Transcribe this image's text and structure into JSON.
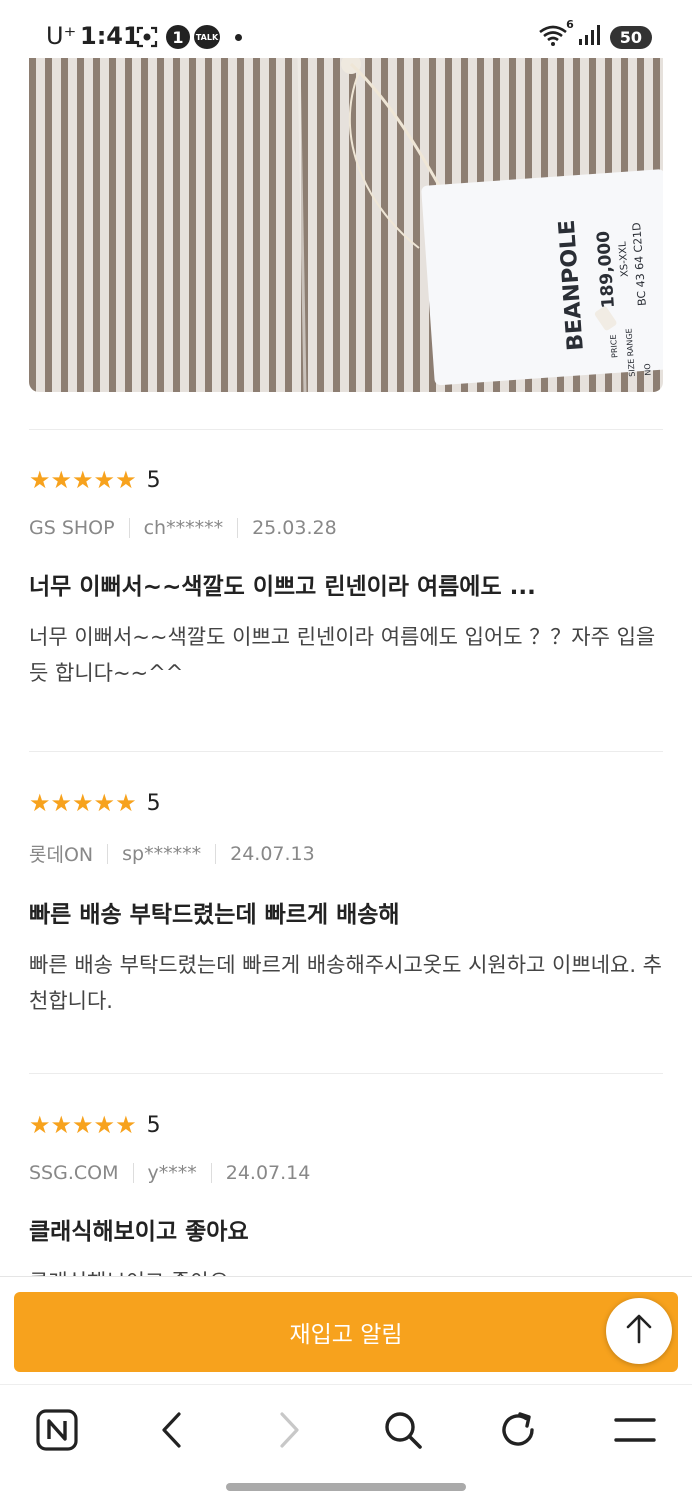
{
  "status_bar": {
    "carrier": "U⁺",
    "time": "1:41",
    "notification_count": "1",
    "talk_label": "TALK",
    "wifi_badge": "6",
    "battery": "50"
  },
  "product_image": {
    "tag_brand": "BEANPOLE",
    "tag_price": "189,000",
    "tag_size": "XS-XXL",
    "tag_code": "BC 43 64 C21D",
    "tag_price_label": "PRICE",
    "tag_size_label": "SIZE RANGE",
    "tag_no_label": "NO"
  },
  "reviews": [
    {
      "stars": "★★★★★",
      "score": "5",
      "source": "GS SHOP",
      "user": "ch******",
      "date": "25.03.28",
      "title": "너무 이뻐서~~색깔도 이쁘고 린넨이라 여름에도 ...",
      "body": "너무 이뻐서~~색깔도 이쁘고 린넨이라 여름에도 입어도 ？？자주 입을듯 합니다~~^^"
    },
    {
      "stars": "★★★★★",
      "score": "5",
      "source": "롯데ON",
      "user": "sp******",
      "date": "24.07.13",
      "title": "빠른 배송 부탁드렸는데 빠르게 배송해",
      "body": "빠른 배송 부탁드렸는데 빠르게 배송해주시고옷도 시원하고 이쁘네요. 추천합니다."
    },
    {
      "stars": "★★★★★",
      "score": "5",
      "source": "SSG.COM",
      "user": "y****",
      "date": "24.07.14",
      "title": "클래식해보이고 좋아요",
      "body": "클래식해보이고 좋아요"
    }
  ],
  "restock_button": "재입고 알림",
  "colors": {
    "accent": "#f7a21d"
  },
  "nav_icons": [
    "naver-n-icon",
    "back-icon",
    "forward-icon",
    "search-icon",
    "refresh-icon",
    "menu-icon"
  ]
}
